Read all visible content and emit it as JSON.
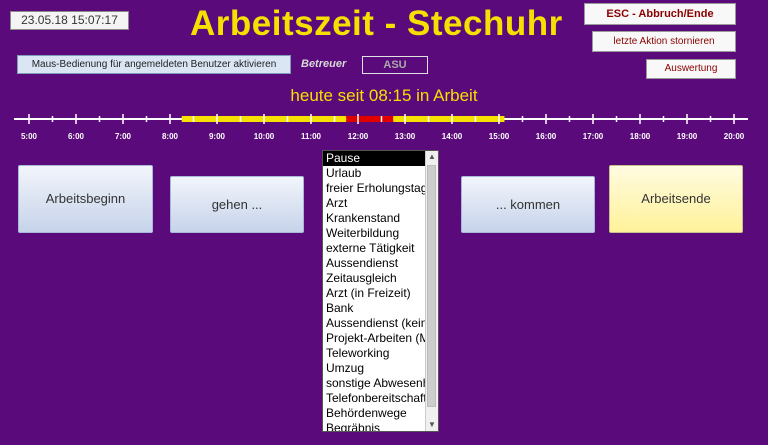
{
  "header": {
    "datetime": "23.05.18 15:07:17",
    "title": "Arbeitszeit - Stechuhr"
  },
  "toolbar": {
    "esc_label": "ESC - Abbruch/Ende",
    "undo_label": "letzte Aktion stornieren",
    "eval_label": "Auswertung"
  },
  "mouse_mode": {
    "label": "Maus-Bedienung für angemeldeten Benutzer aktivieren"
  },
  "betreuer": {
    "label": "Betreuer"
  },
  "asu": {
    "label": "ASU"
  },
  "status": {
    "text": "heute seit 08:15 in Arbeit"
  },
  "timeline": {
    "ticks": [
      "5:00",
      "6:00",
      "7:00",
      "8:00",
      "9:00",
      "10:00",
      "11:00",
      "12:00",
      "13:00",
      "14:00",
      "15:00",
      "16:00",
      "17:00",
      "18:00",
      "19:00",
      "20:00"
    ],
    "segments": [
      {
        "type": "work",
        "from": "8:15",
        "to": "11:45",
        "color": "#f5e000"
      },
      {
        "type": "break",
        "from": "11:45",
        "to": "12:45",
        "color": "#e00000"
      },
      {
        "type": "work",
        "from": "12:45",
        "to": "15:07",
        "color": "#f5e000"
      }
    ]
  },
  "actions": {
    "begin": "Arbeitsbeginn",
    "gehen": "gehen ...",
    "kommen": "... kommen",
    "end": "Arbeitsende"
  },
  "absence_list": {
    "selected": "Pause",
    "items": [
      "Pause",
      "Urlaub",
      "freier Erholungstag",
      "Arzt",
      "Krankenstand",
      "Weiterbildung",
      "externe Tätigkeit",
      "Aussendienst",
      "Zeitausgleich",
      "Arzt (in Freizeit)",
      "Bank",
      "Aussendienst (kein",
      "Projekt-Arbeiten (M",
      "Teleworking",
      "Umzug",
      "sonstige Abwesenh",
      "Telefonbereitschaft",
      "Behördenwege",
      "Begräbnis"
    ]
  },
  "colors": {
    "background": "#5a0a7a",
    "accent_yellow": "#f5e000",
    "break_red": "#e00000"
  }
}
